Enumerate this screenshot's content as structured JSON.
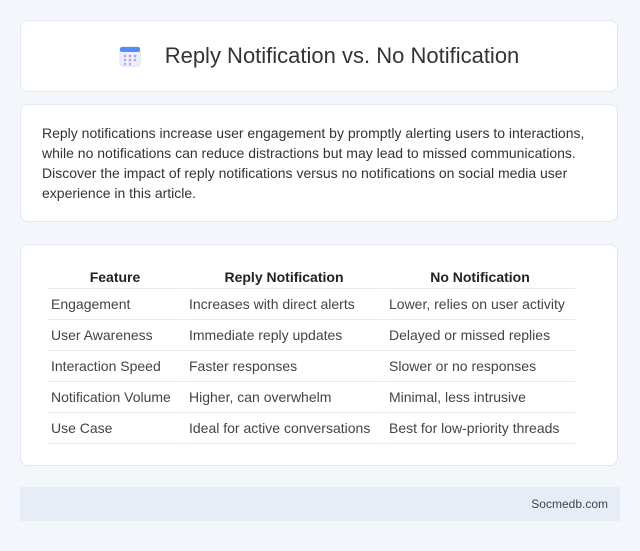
{
  "header": {
    "title": "Reply Notification vs. No Notification",
    "icon": "calendar-icon"
  },
  "intro": {
    "text": "Reply notifications increase user engagement by promptly alerting users to interactions, while no notifications can reduce distractions but may lead to missed communications. Discover the impact of reply notifications versus no notifications on social media user experience in this article."
  },
  "table": {
    "headers": [
      "Feature",
      "Reply Notification",
      "No Notification"
    ],
    "rows": [
      [
        "Engagement",
        "Increases with direct alerts",
        "Lower, relies on user activity"
      ],
      [
        "User Awareness",
        "Immediate reply updates",
        "Delayed or missed replies"
      ],
      [
        "Interaction Speed",
        "Faster responses",
        "Slower or no responses"
      ],
      [
        "Notification Volume",
        "Higher, can overwhelm",
        "Minimal, less intrusive"
      ],
      [
        "Use Case",
        "Ideal for active conversations",
        "Best for low-priority threads"
      ]
    ]
  },
  "footer": {
    "text": "Socmedb.com"
  },
  "colors": {
    "icon_accent": "#4f8ff7",
    "icon_grid": "#b9a4f0",
    "footer_bg": "#e6edf7"
  }
}
